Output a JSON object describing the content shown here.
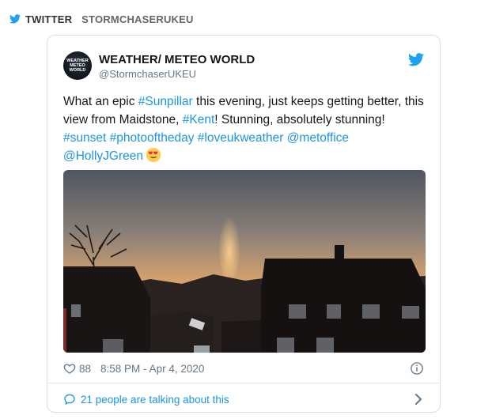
{
  "header": {
    "source": "TWITTER",
    "account": "STORMCHASERUKEU"
  },
  "tweet": {
    "avatar_lines": [
      "WEATHER",
      "METEO",
      "WORLD"
    ],
    "author_name": "WEATHER/ METEO WORLD",
    "author_handle": "@StormchaserUKEU",
    "text": {
      "p1": "What an epic ",
      "h1": "#Sunpillar",
      "p2": " this evening, just keeps getting better, this view from Maidstone, ",
      "h2": "#Kent",
      "p3": "! Stunning, absolutely stunning! ",
      "h3": "#sunset",
      "h4": "#photooftheday",
      "h5": "#loveukweather",
      "h6": "@metoffice",
      "h7": "@HollyJGreen"
    },
    "emoji": "heart-eyes-emoji",
    "likes": "88",
    "timestamp": "8:58 PM - Apr 4, 2020",
    "talking_text": "21 people are talking about this"
  },
  "colors": {
    "link": "#1b95e0",
    "muted": "#657786",
    "border": "#d8dee3"
  }
}
